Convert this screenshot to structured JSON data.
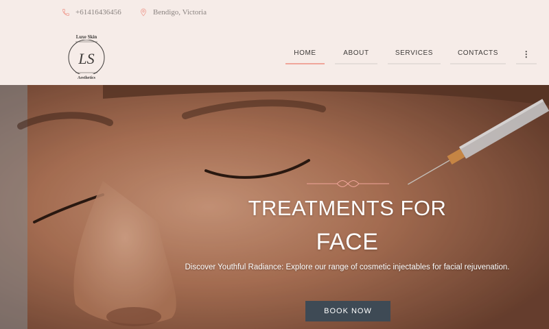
{
  "topbar": {
    "phone": "+61416436456",
    "location": "Bendigo, Victoria"
  },
  "logo": {
    "top_text": "Luxe Skin",
    "monogram": "LS",
    "bottom_text": "Aesthetics"
  },
  "nav": {
    "items": [
      {
        "label": "HOME",
        "active": true
      },
      {
        "label": "ABOUT",
        "active": false
      },
      {
        "label": "SERVICES",
        "active": false
      },
      {
        "label": "CONTACTS",
        "active": false
      }
    ],
    "more": "⋮"
  },
  "hero": {
    "title_line1": "TREATMENTS FOR",
    "title_line2": "FACE",
    "subtitle": "Discover Youthful Radiance: Explore our range of cosmetic injectables for facial rejuvenation.",
    "cta": "BOOK NOW"
  },
  "colors": {
    "background": "#f6ece8",
    "accent": "#f0a59a",
    "button": "#3e4a55"
  }
}
